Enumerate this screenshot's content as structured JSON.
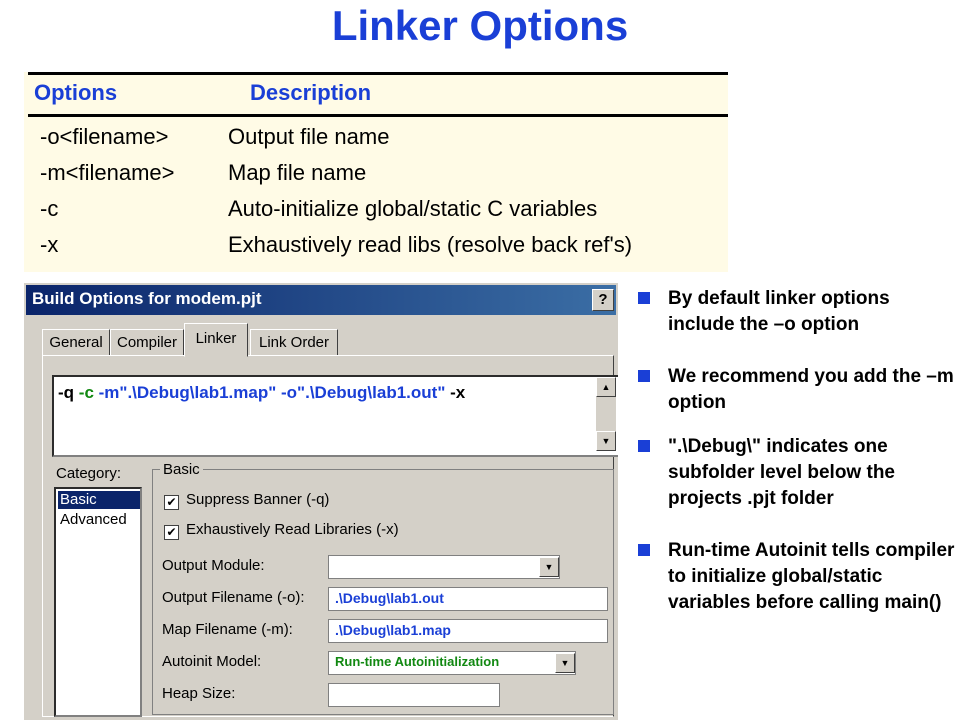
{
  "title": "Linker Options",
  "table": {
    "headers": [
      "Options",
      "Description"
    ],
    "rows": [
      {
        "option": "-o<filename>",
        "description": "Output file name"
      },
      {
        "option": "-m<filename>",
        "description": "Map file name"
      },
      {
        "option": "-c",
        "description": "Auto-initialize global/static C variables"
      },
      {
        "option": "-x",
        "description": "Exhaustively read libs (resolve back ref's)"
      }
    ]
  },
  "dialog": {
    "title": "Build Options for modem.pjt",
    "help_button": "?",
    "tabs": [
      "General",
      "Compiler",
      "Linker",
      "Link Order"
    ],
    "active_tab": "Linker",
    "command_line": {
      "parts": [
        {
          "text": "-q ",
          "color": "#000000"
        },
        {
          "text": "-c ",
          "color": "#118811"
        },
        {
          "text": "-m\".\\Debug\\lab1.map\" -o\".\\Debug\\lab1.out\" ",
          "color": "#1a3fd6"
        },
        {
          "text": "-x",
          "color": "#000000"
        }
      ]
    },
    "category_label": "Category:",
    "categories": [
      "Basic",
      "Advanced"
    ],
    "selected_category": "Basic",
    "group_label": "Basic",
    "checkboxes": [
      {
        "label": "Suppress Banner (-q)",
        "checked": true
      },
      {
        "label": "Exhaustively Read Libraries (-x)",
        "checked": true
      }
    ],
    "fields": [
      {
        "label": "Output Module:",
        "value": "",
        "type": "dropdown"
      },
      {
        "label": "Output Filename (-o):",
        "value": ".\\Debug\\lab1.out",
        "type": "text"
      },
      {
        "label": "Map Filename (-m):",
        "value": ".\\Debug\\lab1.map",
        "type": "text"
      },
      {
        "label": "Autoinit Model:",
        "value": "Run-time Autoinitialization",
        "type": "dropdown",
        "value_color": "#118811"
      },
      {
        "label": "Heap Size:",
        "value": "",
        "type": "text"
      }
    ]
  },
  "bullets": [
    "By default linker options include the –o option",
    "We recommend you add the –m option",
    "\".\\Debug\\\" indicates one subfolder level below the projects .pjt folder",
    "Run-time Autoinit tells compiler to initialize global/static variables before calling main()"
  ],
  "colors": {
    "accent": "#1a3fd6",
    "green": "#118811",
    "table_bg": "#fffbe6",
    "dialog_bg": "#d4d0c8"
  }
}
